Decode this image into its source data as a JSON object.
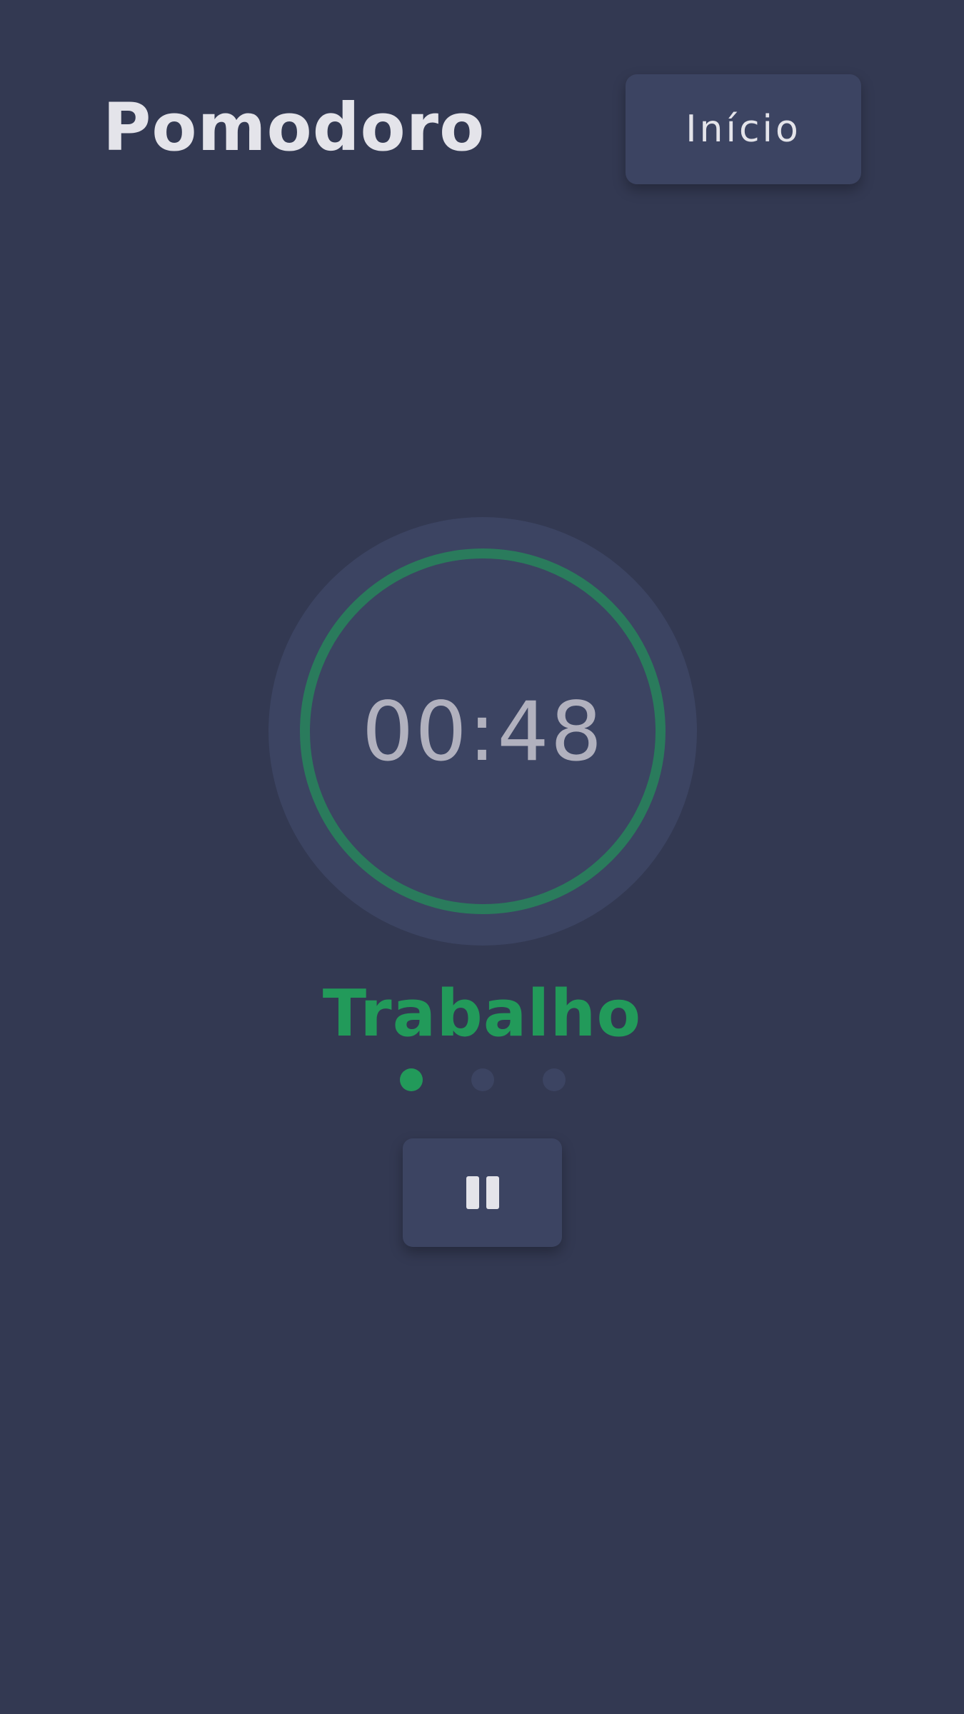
{
  "header": {
    "title": "Pomodoro",
    "home_button_label": "Início"
  },
  "timer": {
    "time_remaining": "00:48",
    "progress": 1.0,
    "phase_label": "Trabalho"
  },
  "cycle": {
    "total": 3,
    "current": 1
  },
  "controls": {
    "play_pause_icon": "pause-icon"
  },
  "colors": {
    "background": "#333952",
    "surface": "#3C4462",
    "accent": "#229A5A",
    "ring": "#2A7B5C",
    "text_primary": "#E4E4EA",
    "text_timer": "#B1B1BE",
    "dot_inactive": "#3C4462"
  }
}
